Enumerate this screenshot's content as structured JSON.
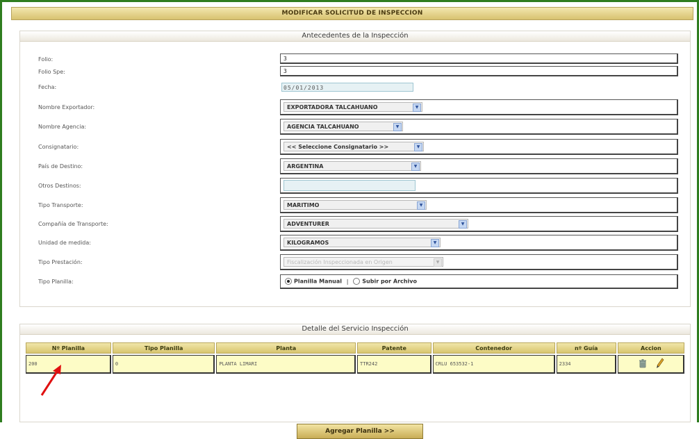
{
  "page": {
    "title": "MODIFICAR SOLICITUD DE INSPECCION",
    "accent_color": "#2f7d1f"
  },
  "antecedentes": {
    "header": "Antecedentes de la Inspección",
    "fields": {
      "folio": {
        "label": "Folio:",
        "value": "3"
      },
      "folio_spec": {
        "label": "Folio Spe:",
        "value": "3"
      },
      "fecha": {
        "label": "Fecha:",
        "value": "05/01/2013"
      },
      "exportador": {
        "label": "Nombre Exportador:",
        "value": "EXPORTADORA TALCAHUANO"
      },
      "agencia": {
        "label": "Nombre Agencia:",
        "value": "AGENCIA TALCAHUANO"
      },
      "consignatario": {
        "label": "Consignatario:",
        "value": "<< Seleccione Consignatario >>"
      },
      "pais_destino": {
        "label": "País de Destino:",
        "value": "ARGENTINA"
      },
      "otros_destinos": {
        "label": "Otros Destinos:",
        "value": ""
      },
      "tipo_transporte": {
        "label": "Tipo Transporte:",
        "value": "MARITIMO"
      },
      "compania_transporte": {
        "label": "Compañía de Transporte:",
        "value": "ADVENTURER"
      },
      "unidad_medida": {
        "label": "Unidad de medida:",
        "value": "KILOGRAMOS"
      },
      "tipo_prestacion": {
        "label": "Tipo Prestación:",
        "value": "Fiscalización Inspeccionada en Origen"
      },
      "tipo_planilla": {
        "label": "Tipo Planilla:",
        "option1": "Planilla Manual",
        "separator": "|",
        "option2": "Subir por Archivo"
      }
    }
  },
  "detalle": {
    "header": "Detalle del Servicio Inspección",
    "columns": [
      "Nº Planilla",
      "Tipo Planilla",
      "Planta",
      "Patente",
      "Contenedor",
      "nº Guía",
      "Accion"
    ],
    "rows": [
      {
        "planilla": "200",
        "tipo": "0",
        "planta": "PLANTA LIMARI",
        "patente": "TTR242",
        "contenedor": "CRLU 653532-1",
        "guia": "2334"
      }
    ],
    "add_button": "Agregar Planilla >>"
  }
}
